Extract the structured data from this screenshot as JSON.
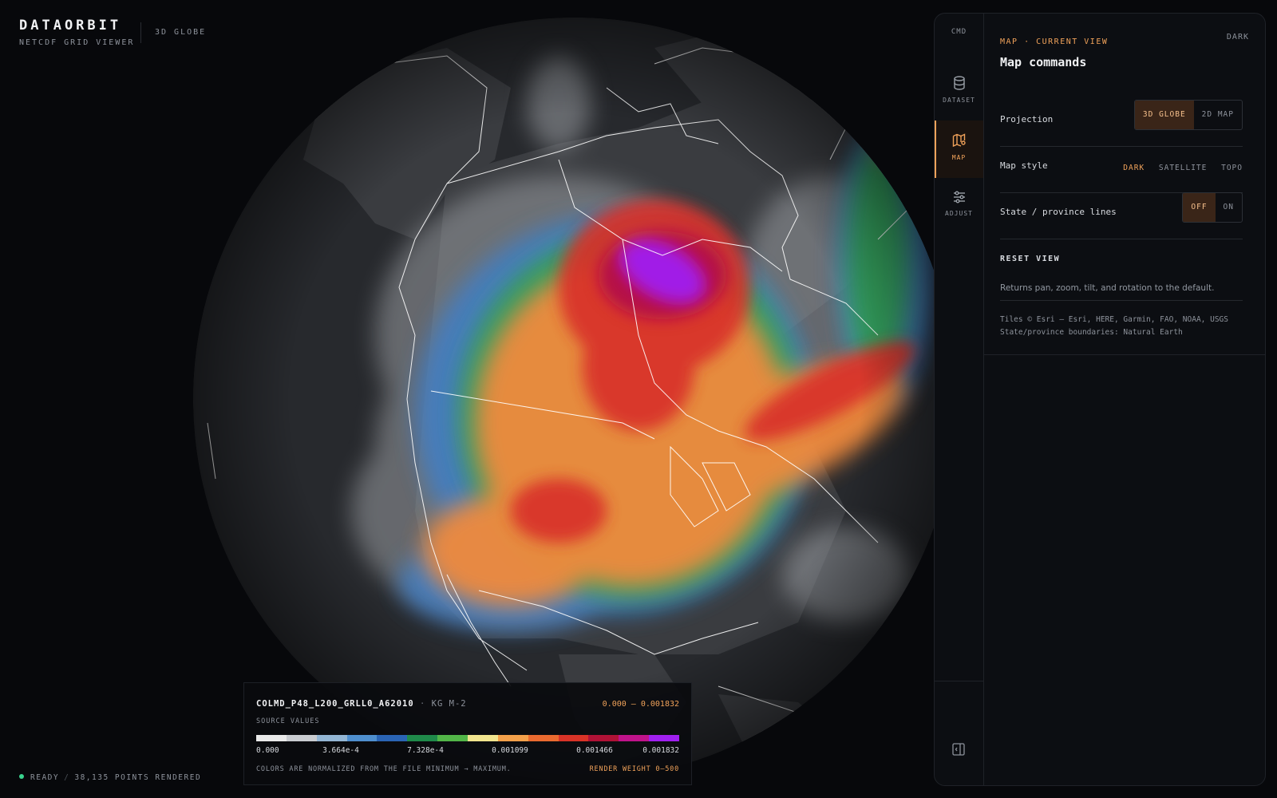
{
  "brand": {
    "title": "DATAORBIT",
    "subtitle": "NETCDF GRID VIEWER",
    "mode": "3D GLOBE"
  },
  "rail": {
    "cmd_label": "CMD",
    "items": [
      {
        "label": "DATASET",
        "icon": "database-icon"
      },
      {
        "label": "MAP",
        "icon": "map-icon",
        "active": true
      },
      {
        "label": "ADJUST",
        "icon": "sliders-icon"
      }
    ],
    "collapse_icon": "panel-collapse-icon"
  },
  "panel": {
    "eyebrow": "MAP · CURRENT VIEW",
    "theme": "DARK",
    "title": "Map commands",
    "projection": {
      "label": "Projection",
      "options": [
        "3D GLOBE",
        "2D MAP"
      ],
      "selected": "3D GLOBE"
    },
    "map_style": {
      "label": "Map style",
      "options": [
        "DARK",
        "SATELLITE",
        "TOPO"
      ],
      "selected": "DARK"
    },
    "state_lines": {
      "label": "State / province lines",
      "options": [
        "OFF",
        "ON"
      ],
      "selected": "OFF"
    },
    "reset": {
      "title": "RESET VIEW",
      "description": "Returns pan, zoom, tilt, and rotation to the default."
    },
    "attribution": [
      "Tiles © Esri — Esri, HERE, Garmin, FAO, NOAA, USGS",
      "State/province boundaries: Natural Earth"
    ]
  },
  "legend": {
    "variable": "COLMD_P48_L200_GRLL0_A62010",
    "separator": "·",
    "unit": "KG M-2",
    "range": "0.000 – 0.001832",
    "source": "SOURCE VALUES",
    "colors": [
      "#e9e9e9",
      "#c9ccd0",
      "#93b6d4",
      "#4f8fce",
      "#2a64b4",
      "#1f8a4a",
      "#52b648",
      "#f1e58e",
      "#f3a04a",
      "#ea6a2f",
      "#d93327",
      "#b01236",
      "#c0138a",
      "#a020f0"
    ],
    "ticks": [
      "0.000",
      "3.664e-4",
      "7.328e-4",
      "0.001099",
      "0.001466",
      "0.001832"
    ],
    "note": "COLORS ARE NORMALIZED FROM THE FILE MINIMUM → MAXIMUM.",
    "weight": "RENDER WEIGHT 0–500"
  },
  "status": {
    "state": "READY",
    "sep": "/",
    "points": "38,135 POINTS RENDERED",
    "dot_color": "#39d38e"
  },
  "colors": {
    "accent": "#f0a25a",
    "panel_bg": "#0c0e12",
    "page_bg": "#07080b",
    "globe_bg": "#26282c"
  }
}
